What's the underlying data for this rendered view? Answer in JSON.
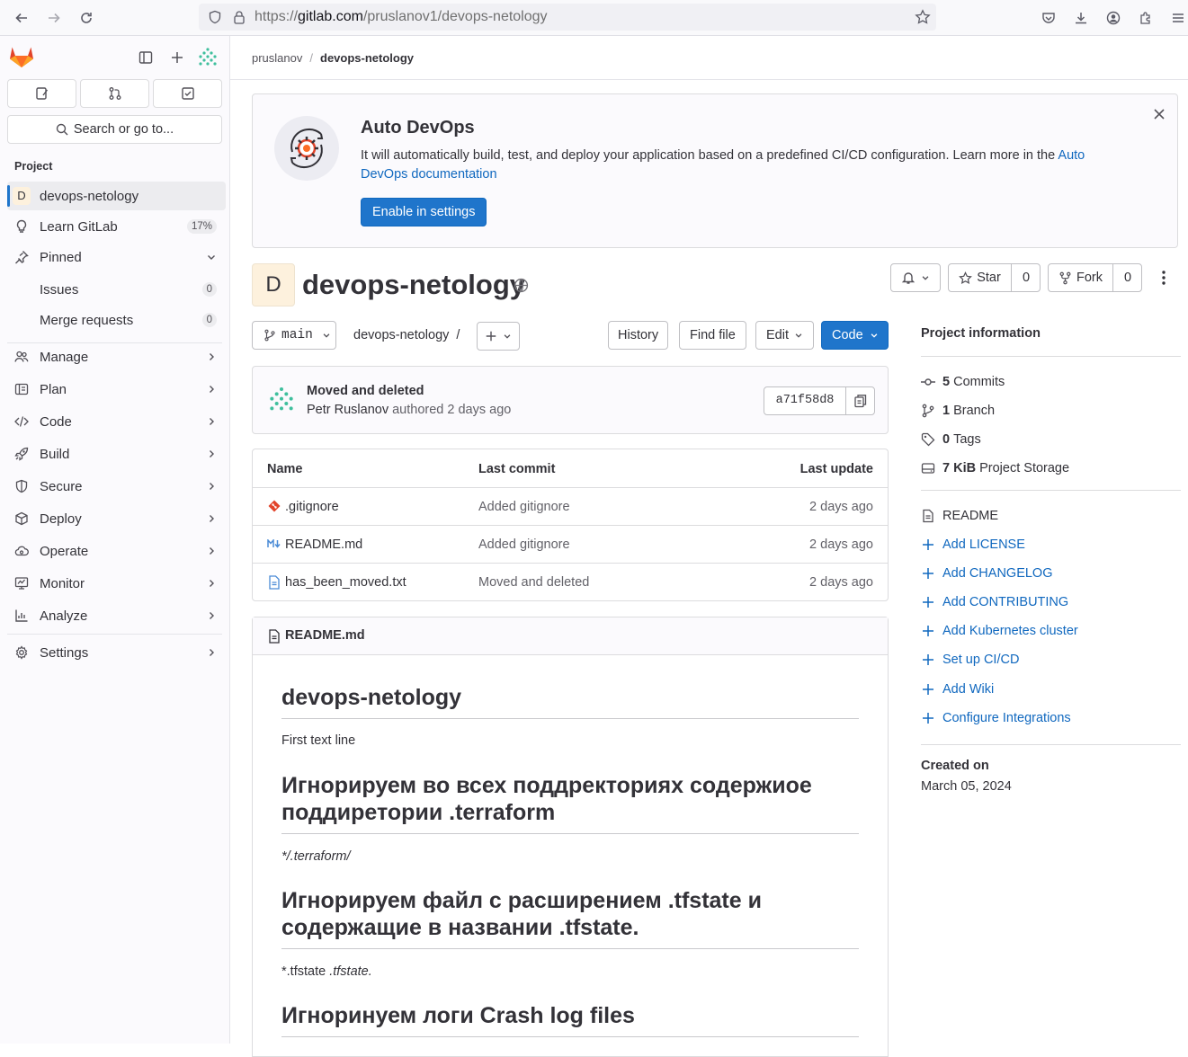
{
  "browser": {
    "url_prefix": "https://",
    "url_domain": "gitlab.com",
    "url_path": "/pruslanov1/devops-netology"
  },
  "sidebar": {
    "search_label": "Search or go to...",
    "section_label": "Project",
    "project_initial": "D",
    "project_name": "devops-netology",
    "learn_label": "Learn GitLab",
    "learn_badge": "17%",
    "pinned_label": "Pinned",
    "pinned_items": [
      {
        "label": "Issues",
        "count": "0"
      },
      {
        "label": "Merge requests",
        "count": "0"
      }
    ],
    "nav": [
      {
        "label": "Manage",
        "icon": "users-icon"
      },
      {
        "label": "Plan",
        "icon": "plan-icon"
      },
      {
        "label": "Code",
        "icon": "code-icon"
      },
      {
        "label": "Build",
        "icon": "rocket-icon"
      },
      {
        "label": "Secure",
        "icon": "shield-icon"
      },
      {
        "label": "Deploy",
        "icon": "deploy-icon"
      },
      {
        "label": "Operate",
        "icon": "cloud-icon"
      },
      {
        "label": "Monitor",
        "icon": "monitor-icon"
      },
      {
        "label": "Analyze",
        "icon": "chart-icon"
      }
    ],
    "settings_label": "Settings"
  },
  "breadcrumb": {
    "owner": "pruslanov",
    "project": "devops-netology"
  },
  "banner": {
    "title": "Auto DevOps",
    "text": "It will automatically build, test, and deploy your application based on a predefined CI/CD configuration. Learn more in the ",
    "link": "Auto DevOps documentation",
    "button": "Enable in settings"
  },
  "project": {
    "initial": "D",
    "name": "devops-netology",
    "star_label": "Star",
    "star_count": "0",
    "fork_label": "Fork",
    "fork_count": "0"
  },
  "repo": {
    "branch": "main",
    "path": "devops-netology",
    "path_sep": "/",
    "history": "History",
    "find_file": "Find file",
    "edit": "Edit",
    "code": "Code"
  },
  "commit": {
    "message": "Moved and deleted",
    "author": "Petr Ruslanov",
    "authored": "authored 2 days ago",
    "sha": "a71f58d8"
  },
  "files": {
    "headers": [
      "Name",
      "Last commit",
      "Last update"
    ],
    "rows": [
      {
        "name": ".gitignore",
        "commit": "Added gitignore",
        "updated": "2 days ago"
      },
      {
        "name": "README.md",
        "commit": "Added gitignore",
        "updated": "2 days ago"
      },
      {
        "name": "has_been_moved.txt",
        "commit": "Moved and deleted",
        "updated": "2 days ago"
      }
    ]
  },
  "readme": {
    "filename": "README.md",
    "h1": "devops-netology",
    "p1": "First text line",
    "h2a_line1": "Игнорируем во всех поддректориях содержиое",
    "h2a_line2": "поддиретории .terraform",
    "p2": "*/.terraform/",
    "h2b_line1": "Игнорируем файл с расширением .tfstate и",
    "h2b_line2": "содержащие в названии .tfstate.",
    "p3_plain": "*.tfstate ",
    "p3_italic": ".tfstate.",
    "h2c": "Игноринуем логи Crash log files"
  },
  "project_info": {
    "title": "Project information",
    "commits_count": "5",
    "commits_label": "Commits",
    "branch_count": "1",
    "branch_label": "Branch",
    "tags_count": "0",
    "tags_label": "Tags",
    "storage_size": "7 KiB",
    "storage_label": "Project Storage",
    "readme": "README",
    "actions": [
      "Add LICENSE",
      "Add CHANGELOG",
      "Add CONTRIBUTING",
      "Add Kubernetes cluster",
      "Set up CI/CD",
      "Add Wiki",
      "Configure Integrations"
    ],
    "created_label": "Created on",
    "created_date": "March 05, 2024"
  },
  "colors": {
    "primary": "#1f75cb",
    "link": "#1068bf",
    "text": "#333238"
  }
}
